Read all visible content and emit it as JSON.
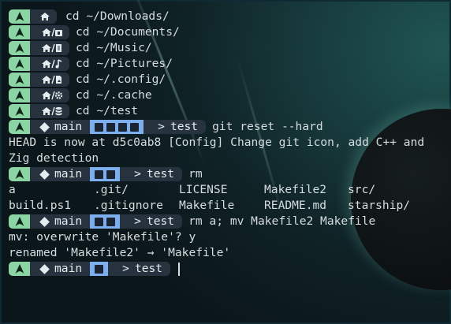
{
  "terminal": {
    "simple_prompts": [
      {
        "icon": "home-icon",
        "command": "cd ~/Downloads/",
        "first": true
      },
      {
        "icon": "folder-download-icon",
        "command": "cd ~/Documents/"
      },
      {
        "icon": "music-folder-icon",
        "command": "cd ~/Music/"
      },
      {
        "icon": "pictures-folder-icon",
        "command": "cd ~/Pictures/"
      },
      {
        "icon": "config-folder-icon",
        "command": "cd ~/.config/"
      },
      {
        "icon": "gear-icon",
        "command": "cd ~/.cache"
      },
      {
        "icon": "database-icon",
        "command": "cd ~/test"
      }
    ],
    "git_prompt_1": {
      "branch": "main",
      "dir": "test",
      "command": "git reset --hard"
    },
    "output_1a": "HEAD is now at d5c0ab8 [Config] Change git icon, add C++ and",
    "output_1b": "Zig detection",
    "git_prompt_2": {
      "branch": "main",
      "dir": "test",
      "command": "rm"
    },
    "ls_row_1": [
      "a",
      ".git/",
      "LICENSE",
      "Makefile2",
      "src/"
    ],
    "ls_row_2": [
      "build.ps1",
      ".gitignore",
      "Makefile",
      "README.md",
      "starship/"
    ],
    "git_prompt_3": {
      "branch": "main",
      "dir": "test",
      "command": "rm a; mv Makefile2 Makefile"
    },
    "output_3a": "mv: overwrite 'Makefile'? y",
    "output_3b": "renamed 'Makefile2' → 'Makefile'",
    "git_prompt_4": {
      "branch": "main",
      "dir": "test",
      "command": ""
    },
    "colors": {
      "arch_green": "#8bd5a5",
      "status_blue": "#7dafef",
      "segment_bg": "#26323d"
    }
  }
}
